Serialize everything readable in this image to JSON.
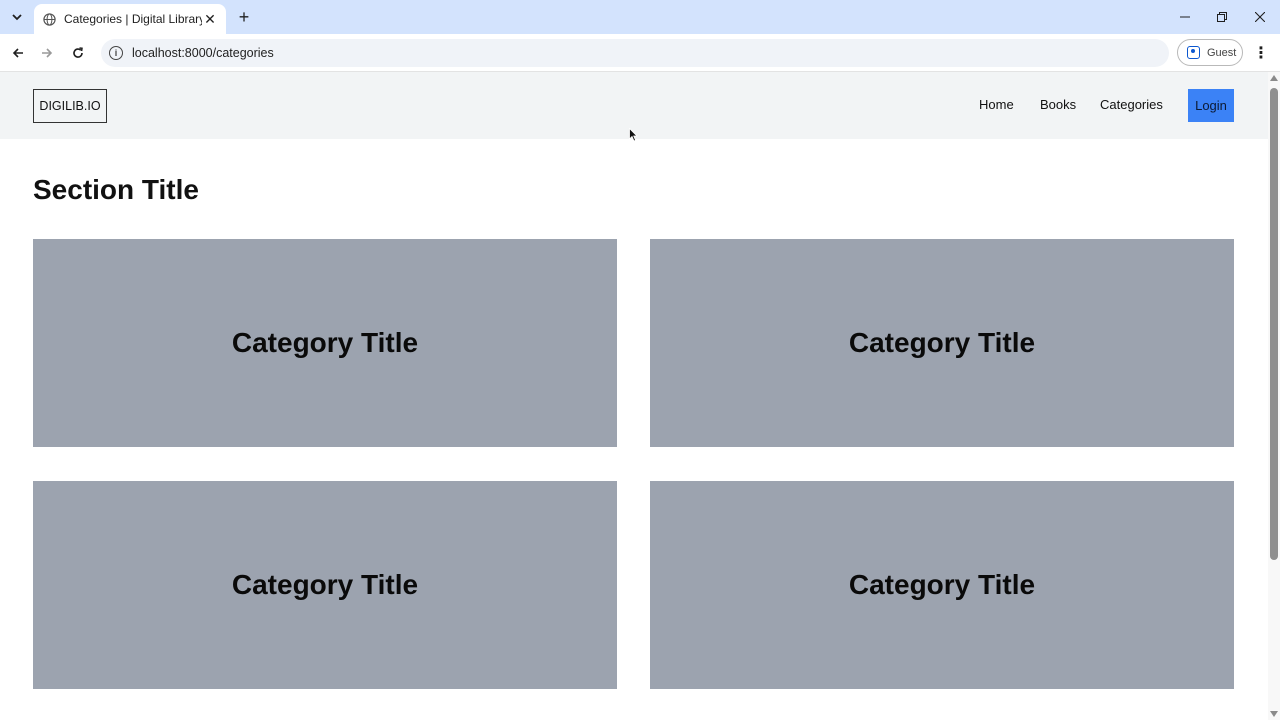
{
  "browser": {
    "tab_title": "Categories | Digital Library",
    "url": "localhost:8000/categories",
    "profile_label": "Guest"
  },
  "site": {
    "logo": "DIGILIB.IO",
    "nav": [
      "Home",
      "Books",
      "Categories"
    ],
    "login_label": "Login",
    "accent_color": "#3b82f6"
  },
  "main": {
    "section_title": "Section Title",
    "cards": [
      {
        "title": "Category Title"
      },
      {
        "title": "Category Title"
      },
      {
        "title": "Category Title"
      },
      {
        "title": "Category Title"
      }
    ]
  }
}
